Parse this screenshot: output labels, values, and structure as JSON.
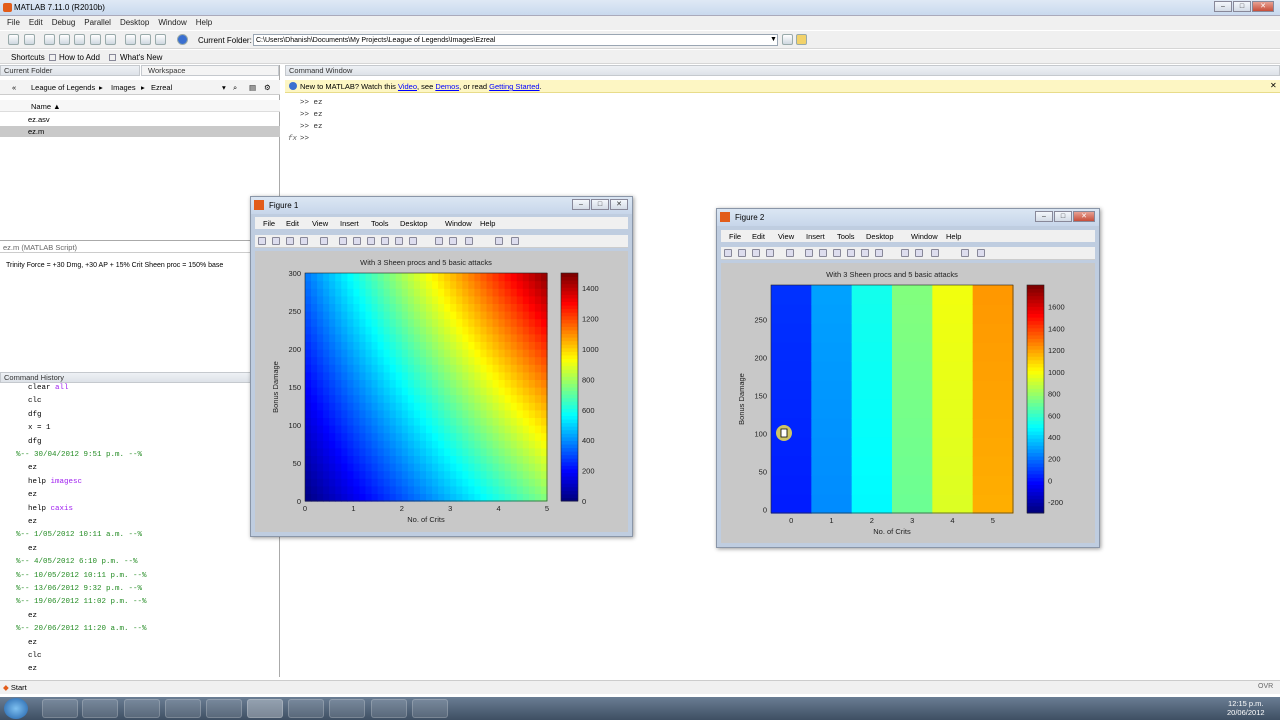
{
  "app": {
    "title": "MATLAB  7.11.0 (R2010b)"
  },
  "menu": [
    "File",
    "Edit",
    "Debug",
    "Parallel",
    "Desktop",
    "Window",
    "Help"
  ],
  "toolbar": {
    "current_folder_label": "Current Folder:",
    "current_folder_path": "C:\\Users\\Dhanish\\Documents\\My Projects\\League of Legends\\Images\\Ezreal"
  },
  "shortcuts": {
    "shortcuts": "Shortcuts",
    "how_to_add": "How to Add",
    "whats_new": "What's New"
  },
  "current_folder": {
    "header": "Current Folder",
    "workspace_tab": "Workspace",
    "crumbs": [
      "League of Legends",
      "Images",
      "Ezreal"
    ],
    "name_col": "Name ▲",
    "files": [
      "ez.asv",
      "ez.m"
    ]
  },
  "details": {
    "header": "ez.m (MATLAB Script)",
    "text": "Trinity Force = +30 Dmg, +30 AP + 15% Crit Sheen proc = 150% base"
  },
  "history": {
    "header": "Command History",
    "lines": [
      {
        "t": "clear ",
        "k": "all",
        "sep": false
      },
      {
        "t": "clc",
        "sep": false
      },
      {
        "t": "dfg",
        "sep": false
      },
      {
        "t": "x = 1",
        "sep": false
      },
      {
        "t": "dfg",
        "sep": false
      },
      {
        "t": "%-- 30/04/2012 9:51 p.m. --%",
        "sep": true
      },
      {
        "t": "ez",
        "sep": false
      },
      {
        "t": "help ",
        "k": "imagesc",
        "sep": false
      },
      {
        "t": "ez",
        "sep": false
      },
      {
        "t": "help ",
        "k": "caxis",
        "sep": false
      },
      {
        "t": "ez",
        "sep": false
      },
      {
        "t": "%-- 1/05/2012 10:11 a.m. --%",
        "sep": true
      },
      {
        "t": "ez",
        "sep": false
      },
      {
        "t": "%-- 4/05/2012 6:10 p.m. --%",
        "sep": true
      },
      {
        "t": "%-- 10/05/2012 10:11 p.m. --%",
        "sep": true
      },
      {
        "t": "%-- 13/06/2012 9:32 p.m. --%",
        "sep": true
      },
      {
        "t": "%-- 19/06/2012 11:02 p.m. --%",
        "sep": true
      },
      {
        "t": "ez",
        "sep": false
      },
      {
        "t": "%-- 20/06/2012 11:20 a.m. --%",
        "sep": true
      },
      {
        "t": "ez",
        "sep": false
      },
      {
        "t": "clc",
        "sep": false
      },
      {
        "t": "ez",
        "sep": false
      }
    ]
  },
  "command_window": {
    "header": "Command Window",
    "new_msg": "New to MATLAB? Watch this ",
    "video": "Video",
    "see": ", see ",
    "demos": "Demos",
    "or_read": ", or read ",
    "getting_started": "Getting Started",
    "dot": ".",
    "lines": [
      ">> ez",
      ">> ez",
      ">> ez"
    ],
    "prompt": ">>",
    "fx": "fx"
  },
  "figure1": {
    "title": "Figure 1",
    "menu": [
      "File",
      "Edit",
      "View",
      "Insert",
      "Tools",
      "Desktop",
      "Window",
      "Help"
    ]
  },
  "figure2": {
    "title": "Figure 2",
    "menu": [
      "File",
      "Edit",
      "View",
      "Insert",
      "Tools",
      "Desktop",
      "Window",
      "Help"
    ]
  },
  "chart_data": [
    {
      "type": "heatmap",
      "title": "With 3 Sheen procs and 5 basic attacks",
      "xlabel": "No. of Crits",
      "ylabel": "Bonus Damage",
      "xlim": [
        0,
        5
      ],
      "ylim": [
        0,
        300
      ],
      "x_ticks": [
        "0",
        "1",
        "2",
        "3",
        "4",
        "5"
      ],
      "y_ticks": [
        "0",
        "50",
        "100",
        "150",
        "200",
        "250",
        "300"
      ],
      "colorbar_ticks": [
        "0",
        "200",
        "400",
        "600",
        "800",
        "1000",
        "1200",
        "1400"
      ],
      "clim": [
        0,
        1500
      ],
      "colormap": "jet",
      "smooth": true
    },
    {
      "type": "heatmap",
      "title": "With 3 Sheen procs and 5 basic attacks",
      "xlabel": "No. of Crits",
      "ylabel": "Bonus Damage",
      "x_ticks": [
        "0",
        "1",
        "2",
        "3",
        "4",
        "5"
      ],
      "y_ticks": [
        "0",
        "50",
        "100",
        "150",
        "200",
        "250"
      ],
      "colorbar_ticks": [
        "-200",
        "0",
        "200",
        "400",
        "600",
        "800",
        "1000",
        "1200",
        "1400",
        "1600"
      ],
      "clim": [
        -300,
        1800
      ],
      "colormap": "jet",
      "columns": [
        0,
        1,
        2,
        3,
        4,
        5
      ],
      "column_values": [
        20,
        250,
        480,
        710,
        940,
        1180
      ]
    }
  ],
  "taskbar": {
    "start": "Start",
    "time": "12:15 p.m.",
    "date": "20/06/2012",
    "ovr": "OVR"
  }
}
